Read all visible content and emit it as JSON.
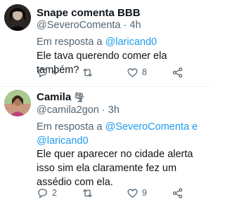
{
  "tweets": [
    {
      "display_name": "Snape comenta BBB",
      "handle": "@SeveroComenta",
      "separator": " · ",
      "time": "4h",
      "reply_prefix": "Em resposta a ",
      "reply_to": "@laricand0",
      "reply_to_second": "",
      "reply_joiner": "",
      "text": "Ele tava querendo comer ela também?",
      "replies": "4",
      "retweets": "",
      "likes": "8"
    },
    {
      "display_name": "Camila",
      "name_emoji": "🌪",
      "handle": "@camila2gon",
      "separator": " · ",
      "time": "3h",
      "reply_prefix": "Em resposta a ",
      "reply_to": "@SeveroComenta",
      "reply_joiner": " e ",
      "reply_to_second": "@laricand0",
      "text": "Ele quer aparecer no cidade alerta isso sim ela claramente fez um assédio com ela.",
      "replies": "2",
      "retweets": "",
      "likes": "9"
    }
  ],
  "colors": {
    "link": "#1d9bf0",
    "secondary_text": "#536471",
    "primary_text": "#0f1419",
    "divider": "#eff3f4"
  },
  "icons": [
    "reply-icon",
    "retweet-icon",
    "like-icon",
    "share-icon"
  ]
}
